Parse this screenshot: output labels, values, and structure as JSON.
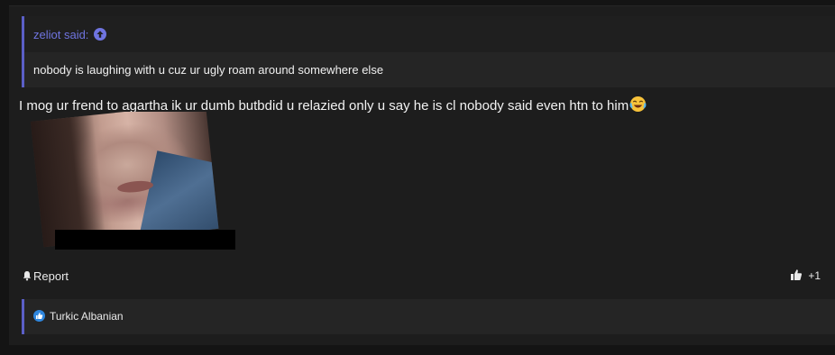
{
  "quote": {
    "author": "zeliot said:",
    "text": "nobody is laughing with u cuz ur ugly roam around somewhere else"
  },
  "post": {
    "message": "I mog ur frend to agartha ik ur dumb butbdid u relazied only u say he is cl nobody said even htn to him",
    "emoji": "laughing-crying-emoji"
  },
  "actions": {
    "report_label": "Report",
    "reaction_count": "+1"
  },
  "reactions": {
    "users": "Turkic Albanian"
  },
  "colors": {
    "accent": "#5b5fc7",
    "link": "#6f74e0",
    "like": "#2e86de"
  }
}
